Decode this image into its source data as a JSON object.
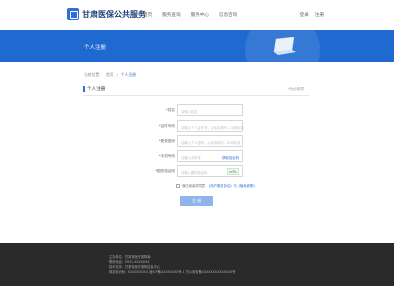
{
  "header": {
    "site_title": "甘肃医保公共服务",
    "nav": [
      "首页",
      "服务查询",
      "服务中心",
      "信息咨询"
    ],
    "login": "登录",
    "register": "注册"
  },
  "banner": {
    "title": "个人注册"
  },
  "breadcrumb": [
    "当前位置：",
    "首页",
    "/",
    "个人注册"
  ],
  "section": {
    "title": "个人注册",
    "note": "*为必填项"
  },
  "form": {
    "name": {
      "label": "姓名",
      "placeholder": "请输入姓名"
    },
    "id_number": {
      "label": "证件号码",
      "placeholder": "请输入个人证件号，以实际填写…中间标准"
    },
    "password": {
      "label": "登录密码",
      "placeholder": "请输入个人密码，以实际填写…中间标准"
    },
    "phone": {
      "label": "手机号码",
      "placeholder": "请输入手机号",
      "action": "获取验证码"
    },
    "captcha": {
      "label": "图形验证码",
      "placeholder": "请输入图形验证码",
      "image_text": "a7b"
    },
    "agree_text": "我已阅读并同意",
    "agree_link": "《用户服务协议》与《隐私政策》",
    "submit_label": "注 册"
  },
  "footer": {
    "lines": [
      "主办单位：甘肃省医疗保障局",
      "联系电话：0931-XXXXXXX",
      "技术支持：甘肃省医疗保障信息中心",
      "网站标识码：6200000001  陇ICP备XXXXXXXX号-1  甘公网安备XXXXXXXXXXXXXX号"
    ]
  }
}
